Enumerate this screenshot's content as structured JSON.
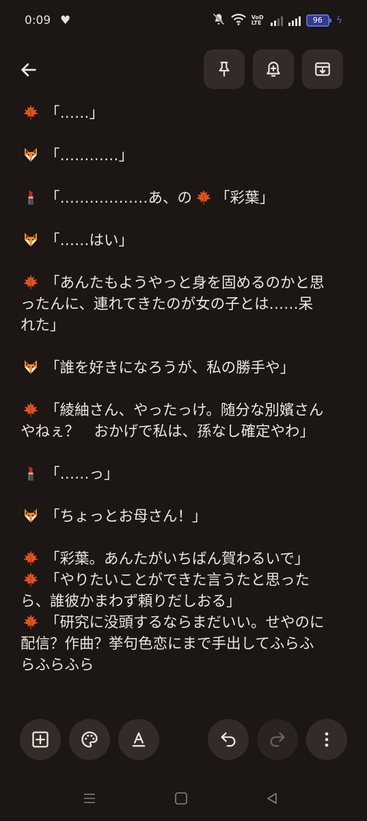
{
  "status_bar": {
    "time": "0:09",
    "volte_label_top": "VoD",
    "volte_label_bottom": "LTE",
    "battery_level": "96",
    "icons": [
      "heart-icon",
      "mute-icon",
      "wifi-icon",
      "signal-icon",
      "battery-icon",
      "charging-icon"
    ]
  },
  "toolbar": {
    "icons": [
      "back-arrow-icon",
      "pin-icon",
      "add-reminder-icon",
      "archive-icon"
    ]
  },
  "note": {
    "blank_1": "",
    "blank_2": "",
    "blank_3": "",
    "blank_4": "",
    "blank_5": "",
    "blank_6": "",
    "blank_7": "",
    "blank_8": "",
    "blank_9": "",
    "blank_10": "",
    "line_1": "「……」",
    "line_2": "「…………」",
    "line_3a": "「………………あ、の",
    "line_3b": "「彩葉」",
    "line_4": "「……はい」",
    "line_5a": "「あんたもようやっと身を固めるのかと思",
    "line_5b": "ったんに、連れてきたのが女の子とは……呆",
    "line_5c": "れた」",
    "line_6": "「誰を好きになろうが、私の勝手や」",
    "line_7a": "「綾紬さん、やったっけ。随分な別嬪さん",
    "line_7b": "やねぇ？　おかげで私は、孫なし確定やわ」",
    "line_8": "「……っ」",
    "line_9": "「ちょっとお母さん！」",
    "line_10": "「彩葉。あんたがいちばん賀わるいで」",
    "line_11a": "「やりたいことができた言うたと思った",
    "line_11b": "ら、誰彼かまわず頼りだしおる」",
    "line_12a": "「研究に没頭するならまだいい。せやのに",
    "line_12b": "配信？作曲？挙句色恋にまで手出してふらふ",
    "line_12c": "らふらふら"
  },
  "bottom_bar": {
    "icons": [
      "add-box-icon",
      "palette-icon",
      "text-format-icon",
      "undo-icon",
      "redo-icon",
      "more-vert-icon"
    ]
  },
  "nav_bar": {
    "icons": [
      "recents-icon",
      "home-icon",
      "back-icon"
    ]
  },
  "colors": {
    "background": "#1c1614",
    "button_bg": "#342b28",
    "text": "#ece6df",
    "battery_accent": "#5b6ad8"
  }
}
